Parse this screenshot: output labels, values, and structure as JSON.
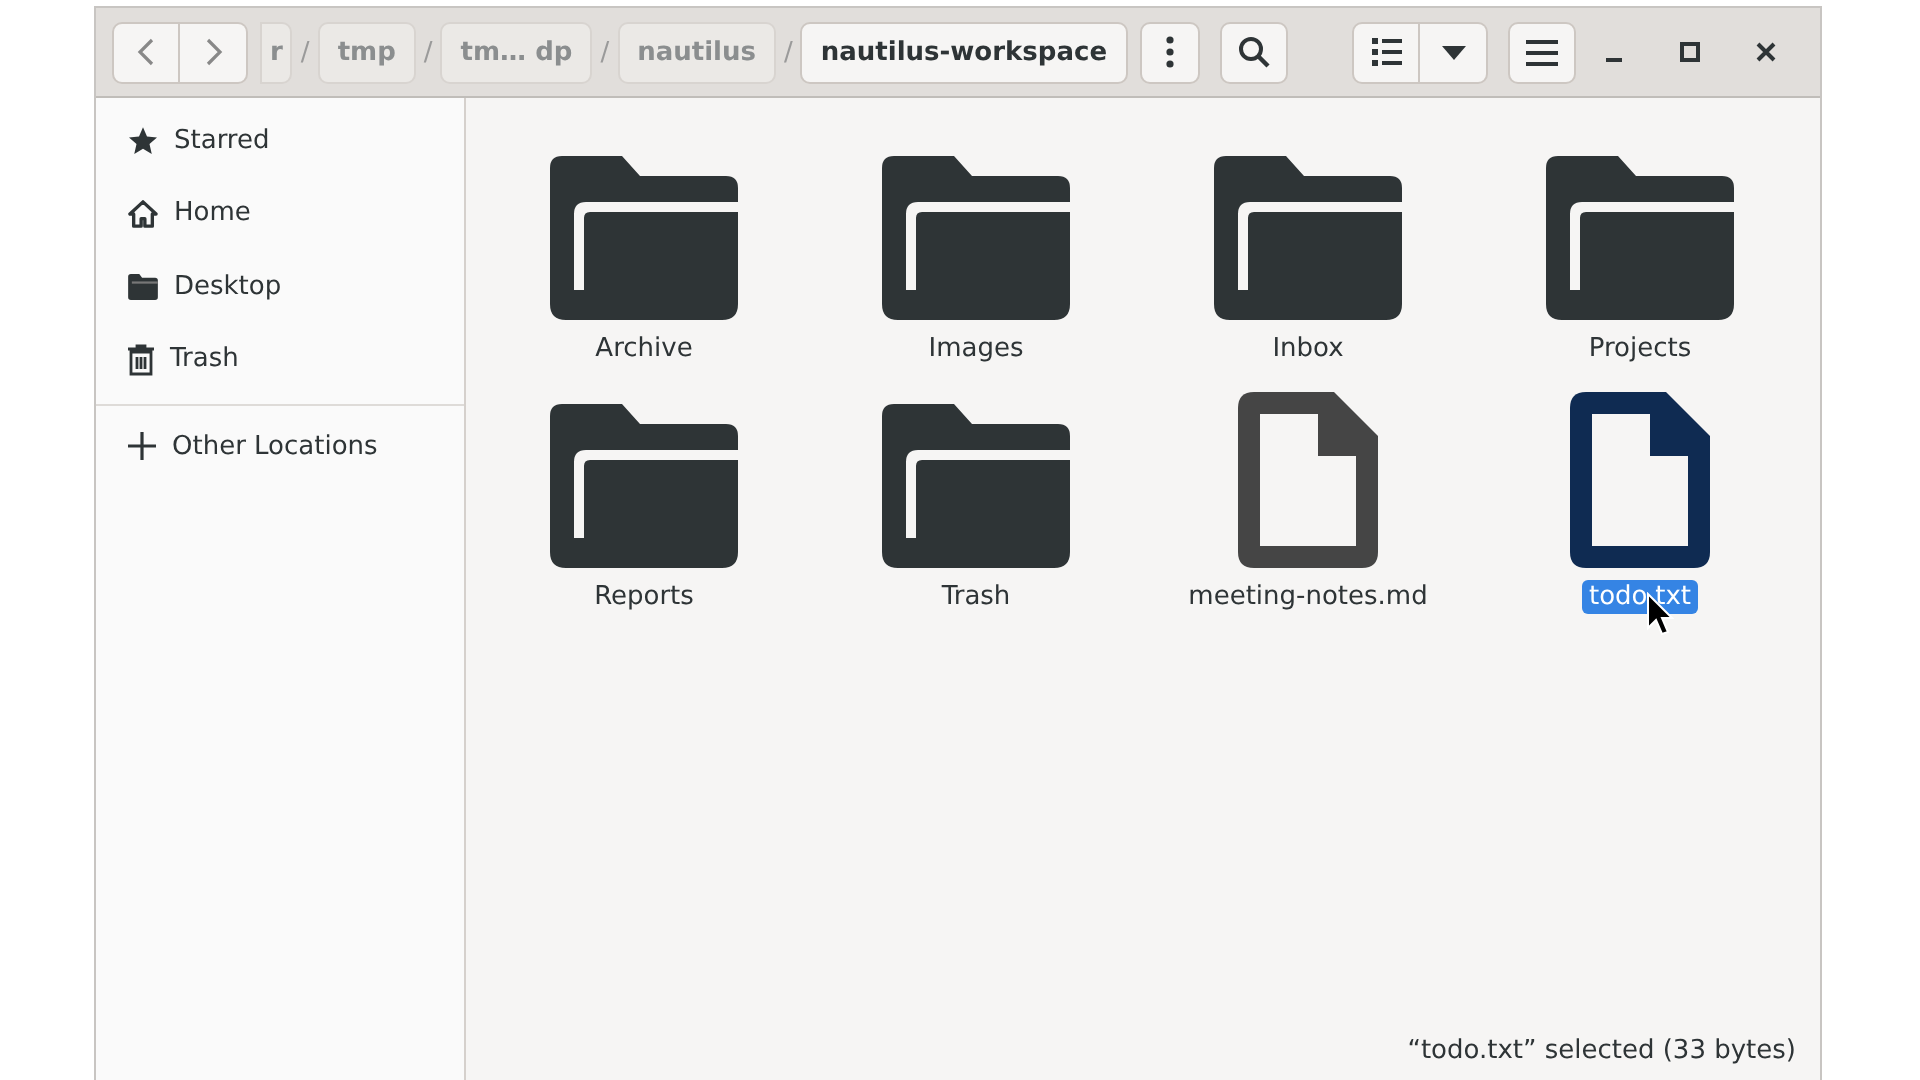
{
  "path": [
    {
      "label": "r",
      "selected": false
    },
    {
      "separator": "/",
      "label": "tmp",
      "selected": false
    },
    {
      "separator": "/",
      "label": "tm… dp",
      "selected": false
    },
    {
      "separator": "/",
      "label": "nautilus",
      "selected": false
    },
    {
      "separator": "/",
      "label": "nautilus-workspace",
      "selected": true
    }
  ],
  "sidebar": {
    "items": [
      {
        "label": "Starred",
        "kind": "star"
      },
      {
        "label": "Home",
        "kind": "home"
      },
      {
        "label": "Desktop",
        "kind": "folder"
      },
      {
        "label": "Trash",
        "kind": "trash"
      }
    ],
    "other": {
      "label": "Other Locations"
    }
  },
  "files": [
    {
      "name": "Archive",
      "kind": "folder",
      "selected": false
    },
    {
      "name": "Images",
      "kind": "folder",
      "selected": false
    },
    {
      "name": "Inbox",
      "kind": "folder",
      "selected": false
    },
    {
      "name": "Projects",
      "kind": "folder",
      "selected": false
    },
    {
      "name": "Reports",
      "kind": "folder",
      "selected": false
    },
    {
      "name": "Trash",
      "kind": "folder",
      "selected": false
    },
    {
      "name": "meeting-notes.md",
      "kind": "document",
      "selected": false
    },
    {
      "name": "todo.txt",
      "kind": "document",
      "selected": true
    }
  ],
  "status_bar": "“todo.txt” selected (33 bytes)"
}
